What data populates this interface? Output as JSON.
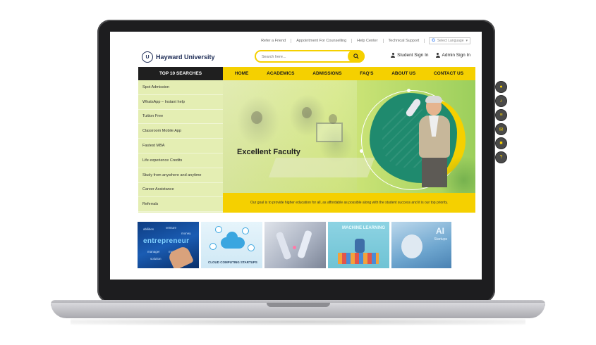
{
  "toplinks": {
    "refer": "Refer a Friend",
    "appointment": "Appointment For Counselling",
    "help": "Help Center",
    "support": "Technical Support",
    "language": "Select Language"
  },
  "header": {
    "logo_text": "Hayward University",
    "search_placeholder": "Search here...",
    "student_signin": "Student Sign In",
    "admin_signin": "Admin Sign In"
  },
  "nav": {
    "left_label": "TOP 10 SEARCHES",
    "items": [
      "HOME",
      "ACADEMICS",
      "ADMISSIONS",
      "FAQ'S",
      "ABOUT US",
      "CONTACT US"
    ]
  },
  "searches": [
    "Spot Admission",
    "WhatsApp – Instant help",
    "Tuition Free",
    "Classroom Mobile App",
    "Fastest MBA",
    "Life experience Credits",
    "Study from anywhere and anytime",
    "Career Assistance",
    "Referrals"
  ],
  "banner": {
    "title": "Excellent Faculty",
    "goal": "Our goal is to provide higher education for all, as affordable as possible along with the student success and it is our top priority."
  },
  "thumbs": {
    "entrepreneur_word": "entrepreneur",
    "cloud_caption": "CLOUD COMPUTING STARTUPS",
    "ml_caption": "MACHINE LEARNING",
    "ai_caption": "AI",
    "ai_sub": "Startups"
  },
  "colors": {
    "accent": "#f5d000",
    "nav_dark": "#1f1f1f",
    "brand": "#1c2b55",
    "searches_bg": "#e4eeb3"
  }
}
